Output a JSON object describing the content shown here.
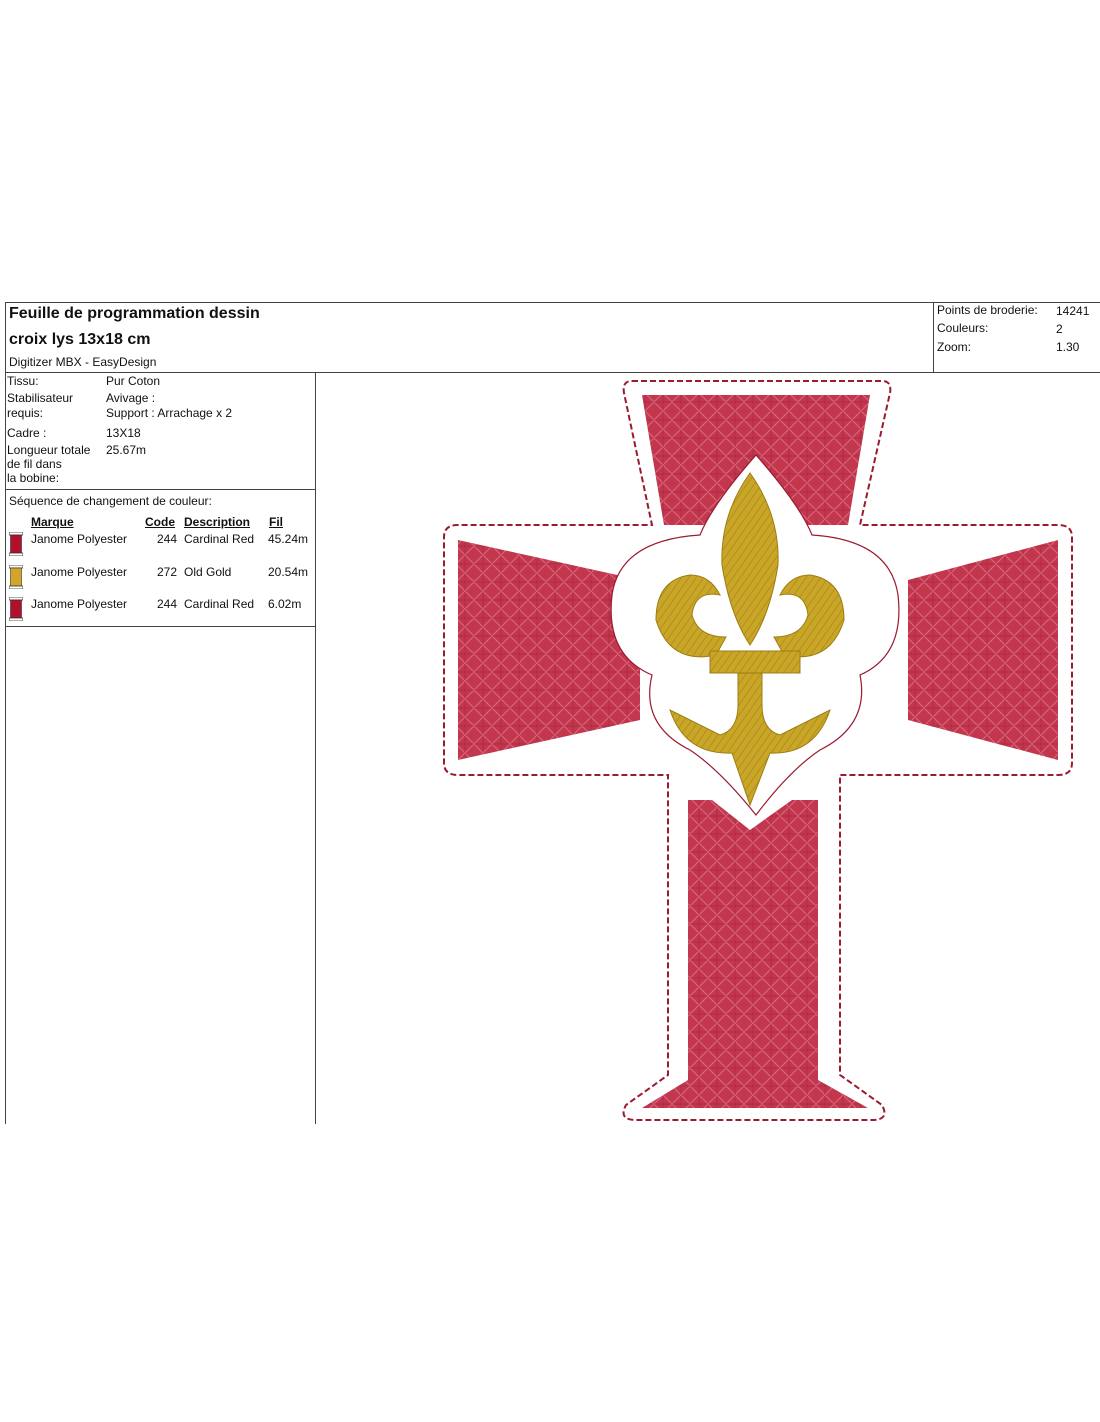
{
  "header": {
    "title_line1": "Feuille de programmation dessin",
    "title_line2": "croix lys 13x18 cm",
    "software": "Digitizer MBX - EasyDesign"
  },
  "stats": [
    {
      "label": "Points de broderie:",
      "value": "14241"
    },
    {
      "label": "Couleurs:",
      "value": "2"
    },
    {
      "label": "Zoom:",
      "value": "1.30"
    }
  ],
  "info": {
    "tissu_label": "Tissu:",
    "tissu_value": "Pur Coton",
    "stab_label1": "Stabilisateur",
    "stab_label2": "requis:",
    "stab_value1": "Avivage :",
    "stab_value2": "Support : Arrachage x 2",
    "cadre_label": "Cadre :",
    "cadre_value": "13X18",
    "length_label1": "Longueur totale",
    "length_label2": "de fil dans",
    "length_label3": "la bobine:",
    "length_value": "25.67m"
  },
  "sequence": {
    "title": "Séquence de changement de couleur:",
    "headers": {
      "brand": "Marque",
      "code": "Code",
      "description": "Description",
      "thread": "Fil"
    },
    "rows": [
      {
        "brand": "Janome Polyester",
        "code": "244",
        "description": "Cardinal Red",
        "thread": "45.24m",
        "color": "#b0102c"
      },
      {
        "brand": "Janome Polyester",
        "code": "272",
        "description": "Old Gold",
        "thread": "20.54m",
        "color": "#d4a52a"
      },
      {
        "brand": "Janome Polyester",
        "code": "244",
        "description": "Cardinal Red",
        "thread": "6.02m",
        "color": "#b0102c"
      }
    ]
  },
  "colors": {
    "cross_fill": "#c2364e",
    "cross_outline": "#9a1a30",
    "lily_fill": "#c9a628",
    "lily_dark": "#9c7d12"
  }
}
